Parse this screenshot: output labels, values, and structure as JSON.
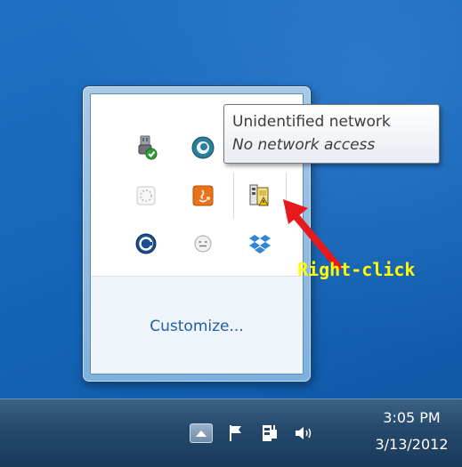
{
  "tray_popup": {
    "icons": [
      {
        "name": "usb-safely-remove-icon"
      },
      {
        "name": "webcam-app-icon"
      },
      {
        "name": "network-icon"
      },
      {
        "name": "sync-status-icon"
      },
      {
        "name": "java-icon"
      },
      {
        "name": "network-warning-icon"
      },
      {
        "name": "app-c-icon"
      },
      {
        "name": "messenger-icon"
      },
      {
        "name": "dropbox-icon"
      }
    ],
    "customize_label": "Customize..."
  },
  "tooltip": {
    "title": "Unidentified network",
    "subtitle": "No network access"
  },
  "annotation": {
    "text": "Right-click",
    "color": "#ffff00",
    "arrow_color": "#e61a1a"
  },
  "taskbar": {
    "time": "3:05 PM",
    "date": "3/13/2012",
    "icons": [
      "show-hidden-icons-button",
      "action-center-flag-icon",
      "power-icon",
      "volume-icon"
    ]
  }
}
